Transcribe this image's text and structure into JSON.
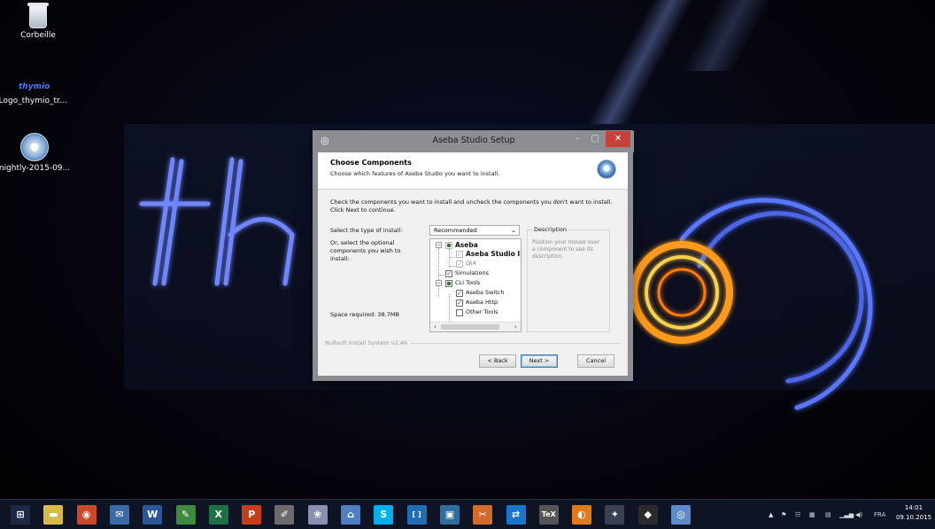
{
  "desktop": {
    "icons": [
      {
        "label": "Corbeille",
        "icon": "recycle-bin-icon"
      },
      {
        "label": "Logo_thymio_tr...",
        "icon_text": "thymio"
      },
      {
        "label": "nightly-2015-09...",
        "icon": "installer-disc-icon"
      }
    ]
  },
  "dialog": {
    "title": "Aseba Studio Setup",
    "window_buttons": {
      "minimize": "–",
      "maximize": "□",
      "close": "✕"
    },
    "header_title": "Choose Components",
    "header_subtitle": "Choose which features of Aseba Studio you want to install.",
    "instructions": "Check the components you want to install and uncheck the components you don't want to install. Click Next to continue.",
    "select_type_label": "Select the type of install:",
    "install_type": "Recommended",
    "optional_label": "Or, select the optional components you wish to install:",
    "space_required": "Space required: 38.7MB",
    "components": [
      {
        "label": "Aseba",
        "state": "partial-dim",
        "level": 0,
        "bold": true
      },
      {
        "label": "Aseba Studio II",
        "state": "checked-dim",
        "level": 1,
        "bold": true
      },
      {
        "label": "Qt4",
        "state": "checked-dim",
        "level": 1
      },
      {
        "label": "Simulations",
        "state": "checked",
        "level": 0
      },
      {
        "label": "CLI Tools",
        "state": "partial",
        "level": 0
      },
      {
        "label": "Aseba Switch",
        "state": "checked",
        "level": 1
      },
      {
        "label": "Aseba Http",
        "state": "checked",
        "level": 1
      },
      {
        "label": "Other Tools",
        "state": "unchecked",
        "level": 1
      }
    ],
    "description_title": "Description",
    "description_text": "Position your mouse over a component to see its description.",
    "branding": "Nullsoft Install System v2.46",
    "buttons": {
      "back": "< Back",
      "next": "Next >",
      "cancel": "Cancel"
    }
  },
  "taskbar": {
    "apps": [
      {
        "name": "start",
        "glyph": "⊞",
        "color": "#1e2a44"
      },
      {
        "name": "file-explorer",
        "glyph": "▬",
        "color": "#d9b948"
      },
      {
        "name": "chrome",
        "glyph": "◉",
        "color": "#c94a2a"
      },
      {
        "name": "thunderbird",
        "glyph": "✉",
        "color": "#3b6aa8"
      },
      {
        "name": "word",
        "glyph": "W",
        "color": "#2b5797"
      },
      {
        "name": "publisher",
        "glyph": "✎",
        "color": "#3f8a3f"
      },
      {
        "name": "excel",
        "glyph": "X",
        "color": "#1d7044"
      },
      {
        "name": "powerpoint",
        "glyph": "P",
        "color": "#c43e1c"
      },
      {
        "name": "inkscape",
        "glyph": "✐",
        "color": "#6b6b6b"
      },
      {
        "name": "paint",
        "glyph": "❀",
        "color": "#8a8fb0"
      },
      {
        "name": "network",
        "glyph": "⌂",
        "color": "#4f7fc0"
      },
      {
        "name": "skype",
        "glyph": "S",
        "color": "#00aff0"
      },
      {
        "name": "brackets",
        "glyph": "[ ]",
        "color": "#1f6fb5"
      },
      {
        "name": "terminal",
        "glyph": "▣",
        "color": "#2d6e9c"
      },
      {
        "name": "gimp",
        "glyph": "✂",
        "color": "#d36b2c"
      },
      {
        "name": "teamviewer",
        "glyph": "⇄",
        "color": "#1874cd"
      },
      {
        "name": "latex",
        "glyph": "TeX",
        "color": "#555"
      },
      {
        "name": "firefox",
        "glyph": "◐",
        "color": "#e07a1c"
      },
      {
        "name": "game",
        "glyph": "✦",
        "color": "#3a3f52"
      },
      {
        "name": "inkscape-2",
        "glyph": "◆",
        "color": "#2b2b2b"
      },
      {
        "name": "aseba-setup",
        "glyph": "◎",
        "color": "#5b8cc9"
      }
    ],
    "tray": {
      "language": "FRA",
      "time": "14:01",
      "date": "09.10.2015"
    }
  }
}
